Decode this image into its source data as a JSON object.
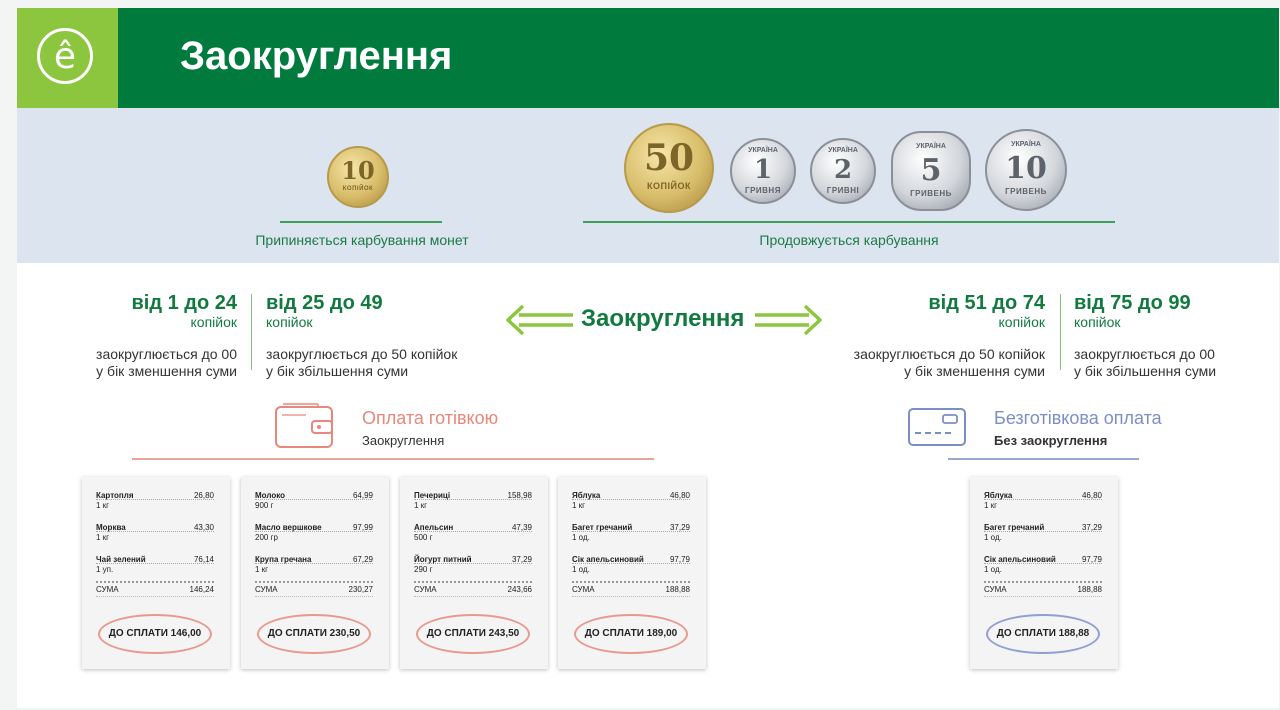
{
  "header": {
    "logo_glyph": "ê",
    "title": "Заокруглення",
    "colors": {
      "green": "#007a3d",
      "lime": "#8cc63f"
    }
  },
  "coins_band": {
    "stopped_label": "Припиняється карбування монет",
    "continued_label": "Продовжується карбування",
    "stopped_coins": [
      {
        "value": "10",
        "unit": "КОПІЙОК"
      }
    ],
    "continued_coins": [
      {
        "value": "50",
        "unit": "КОПІЙОК"
      },
      {
        "value": "1",
        "unit": "ГРИВНЯ"
      },
      {
        "value": "2",
        "unit": "ГРИВНІ"
      },
      {
        "value": "5",
        "unit": "ГРИВЕНЬ"
      },
      {
        "value": "10",
        "unit": "ГРИВЕНЬ"
      }
    ],
    "coin_mint_text": "УКРАЇНА"
  },
  "rounding": {
    "center_label": "Заокруглення",
    "ranges": [
      {
        "range": "від 1 до 24",
        "unit": "копійок",
        "desc1": "заокруглюється до 00",
        "desc2": "у бік зменшення суми"
      },
      {
        "range": "від 25 до 49",
        "unit": "копійок",
        "desc1": "заокруглюється до 50 копійок",
        "desc2": "у бік збільшення суми"
      },
      {
        "range": "від 51 до 74",
        "unit": "копійок",
        "desc1": "заокруглюється до 50 копійок",
        "desc2": "у бік зменшення суми"
      },
      {
        "range": "від 75 до 99",
        "unit": "копійок",
        "desc1": "заокруглюється до 00",
        "desc2": "у бік збільшення суми"
      }
    ]
  },
  "cash": {
    "title": "Оплата готівкою",
    "subtitle": "Заокруглення",
    "icon": "wallet-icon",
    "color": "#e8877c"
  },
  "cashless": {
    "title": "Безготівкова оплата",
    "subtitle": "Без заокруглення",
    "icon": "card-icon",
    "color": "#7d8ec6"
  },
  "receipts": [
    {
      "items": [
        {
          "name": "Картопля",
          "price": "26,80",
          "qty": "1 кг"
        },
        {
          "name": "Морква",
          "price": "43,30",
          "qty": "1 кг"
        },
        {
          "name": "Чай зелений",
          "price": "76,14",
          "qty": "1 уп."
        }
      ],
      "sum_label": "СУМА",
      "sum": "146,24",
      "to_pay": "ДО СПЛАТИ  146,00"
    },
    {
      "items": [
        {
          "name": "Молоко",
          "price": "64,99",
          "qty": "900 г"
        },
        {
          "name": "Масло вершкове",
          "price": "97,99",
          "qty": "200 гр"
        },
        {
          "name": "Крупа гречана",
          "price": "67,29",
          "qty": "1 кг"
        }
      ],
      "sum_label": "СУМА",
      "sum": "230,27",
      "to_pay": "ДО СПЛАТИ  230,50"
    },
    {
      "items": [
        {
          "name": "Печериці",
          "price": "158,98",
          "qty": "1 кг"
        },
        {
          "name": "Апельсин",
          "price": "47,39",
          "qty": "500 г"
        },
        {
          "name": "Йогурт питний",
          "price": "37,29",
          "qty": "290 г"
        }
      ],
      "sum_label": "СУМА",
      "sum": "243,66",
      "to_pay": "ДО СПЛАТИ  243,50"
    },
    {
      "items": [
        {
          "name": "Яблука",
          "price": "46,80",
          "qty": "1 кг"
        },
        {
          "name": "Багет гречаний",
          "price": "37,29",
          "qty": "1 од."
        },
        {
          "name": "Сік апельсиновий",
          "price": "97,79",
          "qty": "1 од."
        }
      ],
      "sum_label": "СУМА",
      "sum": "188,88",
      "to_pay": "ДО СПЛАТИ  189,00"
    },
    {
      "items": [
        {
          "name": "Яблука",
          "price": "46,80",
          "qty": "1 кг"
        },
        {
          "name": "Багет гречаний",
          "price": "37,29",
          "qty": "1 од."
        },
        {
          "name": "Сік апельсиновий",
          "price": "97,79",
          "qty": "1 од."
        }
      ],
      "sum_label": "СУМА",
      "sum": "188,88",
      "to_pay": "ДО СПЛАТИ  188,88"
    }
  ]
}
